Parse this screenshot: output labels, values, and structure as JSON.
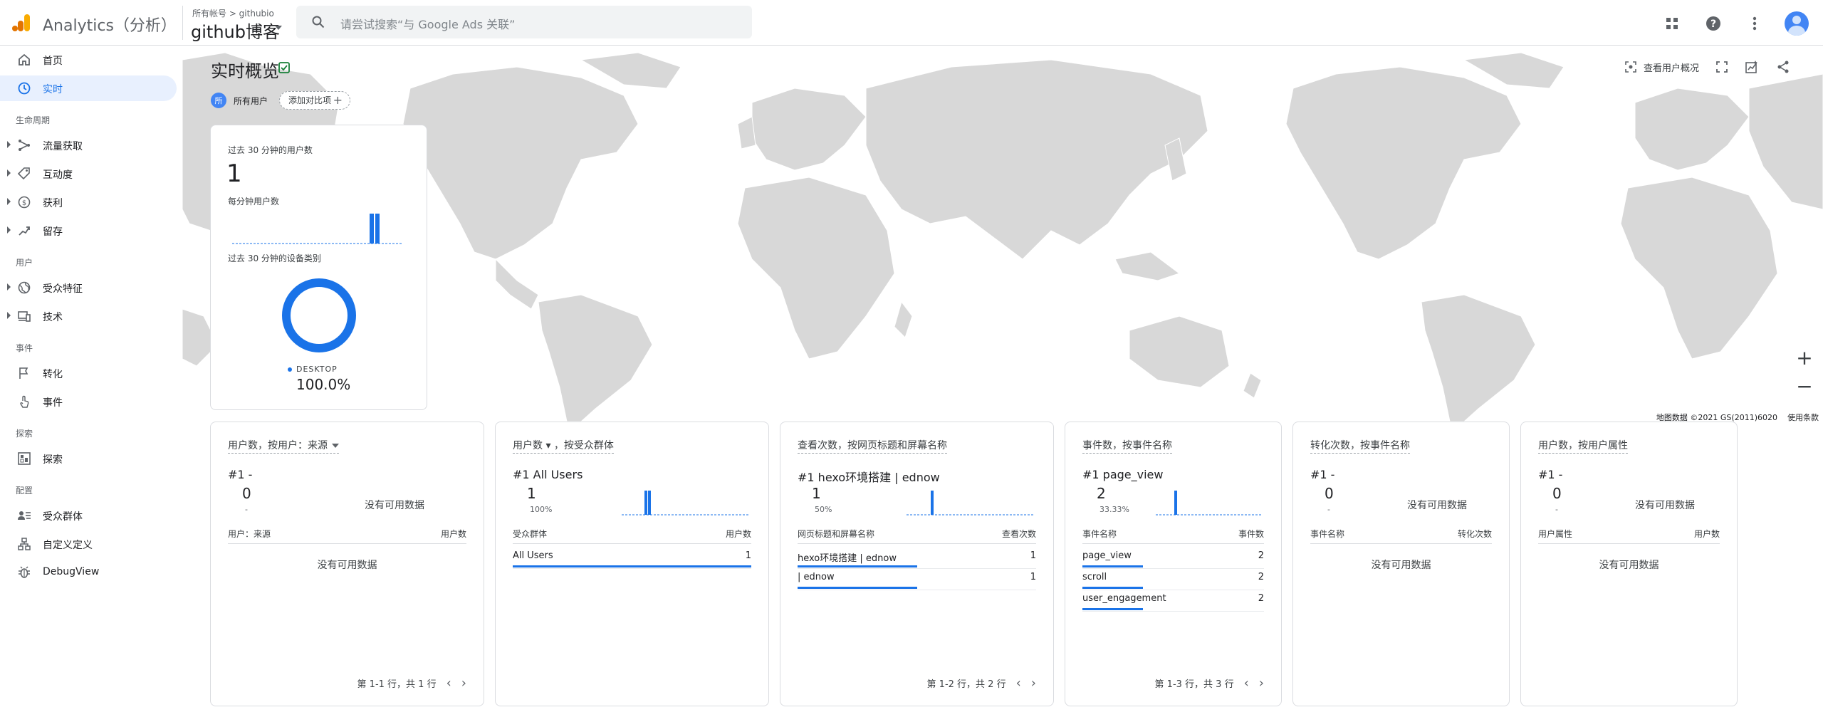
{
  "topbar": {
    "app_title": "Analytics（分析）",
    "breadcrumb": "所有帐号 > githubio",
    "property": "github博客",
    "search_placeholder": "请尝试搜索“与 Google Ads 关联”"
  },
  "sidebar": {
    "items": [
      {
        "label": "首页",
        "icon": "home-icon"
      },
      {
        "label": "实时",
        "icon": "clock-icon"
      },
      {
        "label": "流量获取",
        "icon": "acquisition-icon"
      },
      {
        "label": "互动度",
        "icon": "engagement-icon"
      },
      {
        "label": "获利",
        "icon": "monetization-icon"
      },
      {
        "label": "留存",
        "icon": "retention-icon"
      },
      {
        "label": "受众特征",
        "icon": "globe-icon"
      },
      {
        "label": "技术",
        "icon": "devices-icon"
      },
      {
        "label": "转化",
        "icon": "flag-icon"
      },
      {
        "label": "事件",
        "icon": "touch-icon"
      },
      {
        "label": "探索",
        "icon": "explore-icon"
      },
      {
        "label": "受众群体",
        "icon": "audience-icon"
      },
      {
        "label": "自定义定义",
        "icon": "custom-definitions-icon"
      },
      {
        "label": "DebugView",
        "icon": "debug-icon"
      }
    ],
    "sections": [
      "生命周期",
      "用户",
      "事件",
      "探索",
      "配置"
    ]
  },
  "page": {
    "title": "实时概览",
    "user_badge": "所",
    "user_chip": "所有用户",
    "compare_chip": "添加对比项",
    "view_user_snapshot": "查看用户概况",
    "map_attribution": "地图数据 ©2021 GS(2011)6020",
    "terms": "使用条款"
  },
  "summary": {
    "users_30min_label": "过去 30 分钟的用户数",
    "users_30min_value": "1",
    "per_minute_label": "每分钟用户数",
    "per_minute_values": [
      0,
      0,
      0,
      0,
      0,
      0,
      0,
      0,
      0,
      0,
      0,
      0,
      0,
      0,
      0,
      0,
      0,
      0,
      0,
      0,
      0,
      0,
      0,
      0,
      1,
      1,
      0,
      0,
      0,
      0
    ],
    "device_label": "过去 30 分钟的设备类别",
    "device_name": "DESKTOP",
    "device_pct": "100.0%"
  },
  "cards": [
    {
      "header": "用户数，按用户：来源",
      "rank": "#1  -",
      "top_value": "0",
      "top_pct": "-",
      "no_data_top": "没有可用数据",
      "col_left": "用户：来源",
      "col_right": "用户数",
      "no_data_rows": "没有可用数据",
      "pager": "第 1-1 行，共 1 行"
    },
    {
      "header": "用户数 ▾ ，按受众群体",
      "rank": "#1  All Users",
      "top_value": "1",
      "top_pct": "100%",
      "col_left": "受众群体",
      "col_right": "用户数",
      "rows": [
        {
          "name": "All Users",
          "value": "1"
        }
      ],
      "pager": ""
    },
    {
      "header": "查看次数，按网页标题和屏幕名称",
      "rank": "#1  hexo环境搭建 | ednow",
      "top_value": "1",
      "top_pct": "50%",
      "col_left": "网页标题和屏幕名称",
      "col_right": "查看次数",
      "rows": [
        {
          "name": "hexo环境搭建 | ednow",
          "value": "1"
        },
        {
          "name": "| ednow",
          "value": "1"
        }
      ],
      "pager": "第 1-2 行，共 2 行"
    },
    {
      "header": "事件数，按事件名称",
      "rank": "#1  page_view",
      "top_value": "2",
      "top_pct": "33.33%",
      "col_left": "事件名称",
      "col_right": "事件数",
      "rows": [
        {
          "name": "page_view",
          "value": "2"
        },
        {
          "name": "scroll",
          "value": "2"
        },
        {
          "name": "user_engagement",
          "value": "2"
        }
      ],
      "pager": "第 1-3 行，共 3 行"
    },
    {
      "header": "转化次数，按事件名称",
      "rank": "#1  -",
      "top_value": "0",
      "top_pct": "-",
      "no_data_top": "没有可用数据",
      "col_left": "事件名称",
      "col_right": "转化次数",
      "no_data_rows": "没有可用数据",
      "pager": ""
    },
    {
      "header": "用户数，按用户属性",
      "rank": "#1  -",
      "top_value": "0",
      "top_pct": "-",
      "no_data_top": "没有可用数据",
      "col_left": "用户属性",
      "col_right": "用户数",
      "no_data_rows": "没有可用数据",
      "pager": ""
    }
  ],
  "colors": {
    "accent": "#1a73e8",
    "map_land": "#d6d6d6",
    "map_water": "#ffffff"
  }
}
